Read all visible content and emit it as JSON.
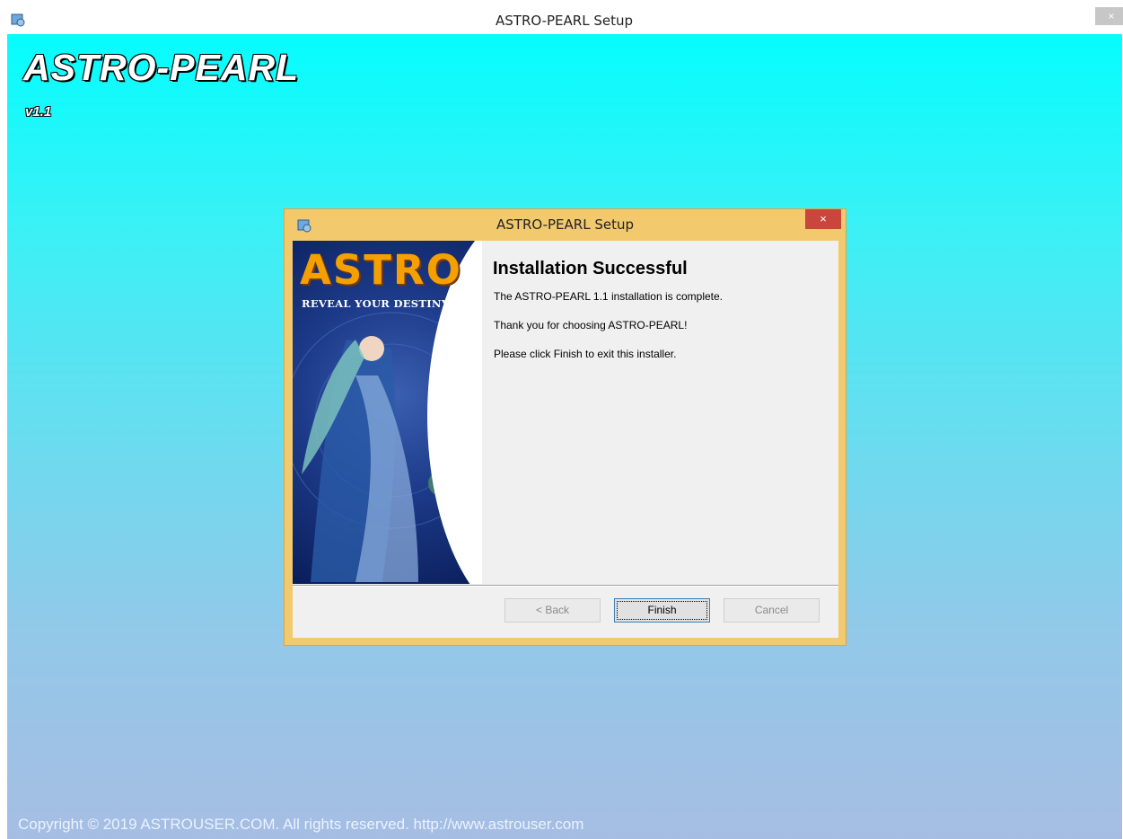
{
  "window": {
    "title": "ASTRO-PEARL Setup",
    "close_label": "×"
  },
  "backdrop": {
    "product_name": "ASTRO-PEARL",
    "version": "v1.1",
    "copyright": "Copyright © 2019 ASTROUSER.COM. All rights reserved. http://www.astrouser.com"
  },
  "dialog": {
    "title": "ASTRO-PEARL Setup",
    "close_label": "×",
    "banner": {
      "logo_text": "ASTRO",
      "tagline": "REVEAL YOUR DESTINY"
    },
    "heading": "Installation Successful",
    "lines": [
      "The ASTRO-PEARL 1.1 installation is complete.",
      "Thank you for choosing ASTRO-PEARL!",
      "Please click Finish to exit this installer."
    ],
    "buttons": {
      "back": "< Back",
      "finish": "Finish",
      "cancel": "Cancel"
    }
  },
  "colors": {
    "backdrop_top": "#05fdfe",
    "backdrop_bottom": "#a6bde3",
    "dialog_frame": "#f2c96d",
    "dialog_close": "#c9463d"
  }
}
